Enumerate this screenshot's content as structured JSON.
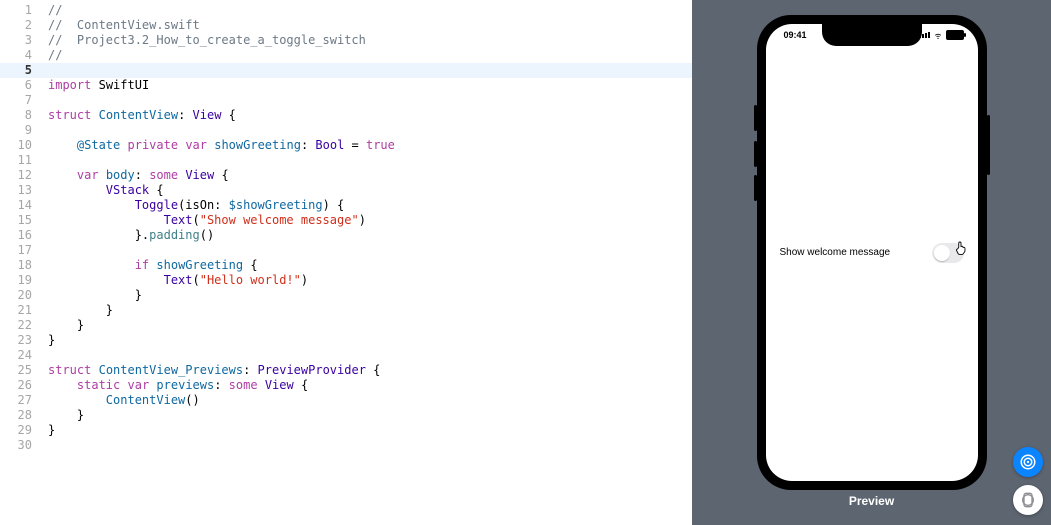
{
  "code": {
    "lines": [
      {
        "n": 1,
        "tokens": [
          {
            "t": "//",
            "c": "c-comment"
          }
        ]
      },
      {
        "n": 2,
        "tokens": [
          {
            "t": "//  ContentView.swift",
            "c": "c-comment"
          }
        ]
      },
      {
        "n": 3,
        "tokens": [
          {
            "t": "//  Project3.2_How_to_create_a_toggle_switch",
            "c": "c-comment"
          }
        ]
      },
      {
        "n": 4,
        "tokens": [
          {
            "t": "//",
            "c": "c-comment"
          }
        ]
      },
      {
        "n": 5,
        "hl": true,
        "tokens": [
          {
            "t": "",
            "c": "c-plain"
          }
        ]
      },
      {
        "n": 6,
        "tokens": [
          {
            "t": "import",
            "c": "c-kw"
          },
          {
            "t": " ",
            "c": "c-plain"
          },
          {
            "t": "SwiftUI",
            "c": "c-plain"
          }
        ]
      },
      {
        "n": 7,
        "tokens": [
          {
            "t": "",
            "c": "c-plain"
          }
        ]
      },
      {
        "n": 8,
        "tokens": [
          {
            "t": "struct",
            "c": "c-kw"
          },
          {
            "t": " ",
            "c": "c-plain"
          },
          {
            "t": "ContentView",
            "c": "c-decl"
          },
          {
            "t": ": ",
            "c": "c-plain"
          },
          {
            "t": "View",
            "c": "c-type"
          },
          {
            "t": " {",
            "c": "c-plain"
          }
        ]
      },
      {
        "n": 9,
        "tokens": [
          {
            "t": "",
            "c": "c-plain"
          }
        ]
      },
      {
        "n": 10,
        "tokens": [
          {
            "t": "    ",
            "c": "c-plain"
          },
          {
            "t": "@State",
            "c": "c-decl"
          },
          {
            "t": " ",
            "c": "c-plain"
          },
          {
            "t": "private",
            "c": "c-kw"
          },
          {
            "t": " ",
            "c": "c-plain"
          },
          {
            "t": "var",
            "c": "c-kw"
          },
          {
            "t": " ",
            "c": "c-plain"
          },
          {
            "t": "showGreeting",
            "c": "c-decl"
          },
          {
            "t": ": ",
            "c": "c-plain"
          },
          {
            "t": "Bool",
            "c": "c-type"
          },
          {
            "t": " = ",
            "c": "c-plain"
          },
          {
            "t": "true",
            "c": "c-kw"
          }
        ]
      },
      {
        "n": 11,
        "tokens": [
          {
            "t": "",
            "c": "c-plain"
          }
        ]
      },
      {
        "n": 12,
        "tokens": [
          {
            "t": "    ",
            "c": "c-plain"
          },
          {
            "t": "var",
            "c": "c-kw"
          },
          {
            "t": " ",
            "c": "c-plain"
          },
          {
            "t": "body",
            "c": "c-decl"
          },
          {
            "t": ": ",
            "c": "c-plain"
          },
          {
            "t": "some",
            "c": "c-kw"
          },
          {
            "t": " ",
            "c": "c-plain"
          },
          {
            "t": "View",
            "c": "c-type"
          },
          {
            "t": " {",
            "c": "c-plain"
          }
        ]
      },
      {
        "n": 13,
        "tokens": [
          {
            "t": "        ",
            "c": "c-plain"
          },
          {
            "t": "VStack",
            "c": "c-type"
          },
          {
            "t": " {",
            "c": "c-plain"
          }
        ]
      },
      {
        "n": 14,
        "tokens": [
          {
            "t": "            ",
            "c": "c-plain"
          },
          {
            "t": "Toggle",
            "c": "c-type"
          },
          {
            "t": "(isOn: ",
            "c": "c-plain"
          },
          {
            "t": "$showGreeting",
            "c": "c-decl"
          },
          {
            "t": ") {",
            "c": "c-plain"
          }
        ]
      },
      {
        "n": 15,
        "tokens": [
          {
            "t": "                ",
            "c": "c-plain"
          },
          {
            "t": "Text",
            "c": "c-type"
          },
          {
            "t": "(",
            "c": "c-plain"
          },
          {
            "t": "\"Show welcome message\"",
            "c": "c-str"
          },
          {
            "t": ")",
            "c": "c-plain"
          }
        ]
      },
      {
        "n": 16,
        "tokens": [
          {
            "t": "            }.",
            "c": "c-plain"
          },
          {
            "t": "padding",
            "c": "c-func"
          },
          {
            "t": "()",
            "c": "c-plain"
          }
        ]
      },
      {
        "n": 17,
        "tokens": [
          {
            "t": "",
            "c": "c-plain"
          }
        ]
      },
      {
        "n": 18,
        "tokens": [
          {
            "t": "            ",
            "c": "c-plain"
          },
          {
            "t": "if",
            "c": "c-kw"
          },
          {
            "t": " ",
            "c": "c-plain"
          },
          {
            "t": "showGreeting",
            "c": "c-decl"
          },
          {
            "t": " {",
            "c": "c-plain"
          }
        ]
      },
      {
        "n": 19,
        "tokens": [
          {
            "t": "                ",
            "c": "c-plain"
          },
          {
            "t": "Text",
            "c": "c-type"
          },
          {
            "t": "(",
            "c": "c-plain"
          },
          {
            "t": "\"Hello world!\"",
            "c": "c-str"
          },
          {
            "t": ")",
            "c": "c-plain"
          }
        ]
      },
      {
        "n": 20,
        "tokens": [
          {
            "t": "            }",
            "c": "c-plain"
          }
        ]
      },
      {
        "n": 21,
        "tokens": [
          {
            "t": "        }",
            "c": "c-plain"
          }
        ]
      },
      {
        "n": 22,
        "tokens": [
          {
            "t": "    }",
            "c": "c-plain"
          }
        ]
      },
      {
        "n": 23,
        "tokens": [
          {
            "t": "}",
            "c": "c-plain"
          }
        ]
      },
      {
        "n": 24,
        "tokens": [
          {
            "t": "",
            "c": "c-plain"
          }
        ]
      },
      {
        "n": 25,
        "tokens": [
          {
            "t": "struct",
            "c": "c-kw"
          },
          {
            "t": " ",
            "c": "c-plain"
          },
          {
            "t": "ContentView_Previews",
            "c": "c-decl"
          },
          {
            "t": ": ",
            "c": "c-plain"
          },
          {
            "t": "PreviewProvider",
            "c": "c-type"
          },
          {
            "t": " {",
            "c": "c-plain"
          }
        ]
      },
      {
        "n": 26,
        "tokens": [
          {
            "t": "    ",
            "c": "c-plain"
          },
          {
            "t": "static",
            "c": "c-kw"
          },
          {
            "t": " ",
            "c": "c-plain"
          },
          {
            "t": "var",
            "c": "c-kw"
          },
          {
            "t": " ",
            "c": "c-plain"
          },
          {
            "t": "previews",
            "c": "c-decl"
          },
          {
            "t": ": ",
            "c": "c-plain"
          },
          {
            "t": "some",
            "c": "c-kw"
          },
          {
            "t": " ",
            "c": "c-plain"
          },
          {
            "t": "View",
            "c": "c-type"
          },
          {
            "t": " {",
            "c": "c-plain"
          }
        ]
      },
      {
        "n": 27,
        "tokens": [
          {
            "t": "        ",
            "c": "c-plain"
          },
          {
            "t": "ContentView",
            "c": "c-decl"
          },
          {
            "t": "()",
            "c": "c-plain"
          }
        ]
      },
      {
        "n": 28,
        "tokens": [
          {
            "t": "    }",
            "c": "c-plain"
          }
        ]
      },
      {
        "n": 29,
        "tokens": [
          {
            "t": "}",
            "c": "c-plain"
          }
        ]
      },
      {
        "n": 30,
        "tokens": [
          {
            "t": "",
            "c": "c-plain"
          }
        ]
      }
    ]
  },
  "preview": {
    "label": "Preview",
    "statusbar": {
      "time": "09:41"
    },
    "app": {
      "toggle_label": "Show welcome message",
      "toggle_on": false
    }
  }
}
